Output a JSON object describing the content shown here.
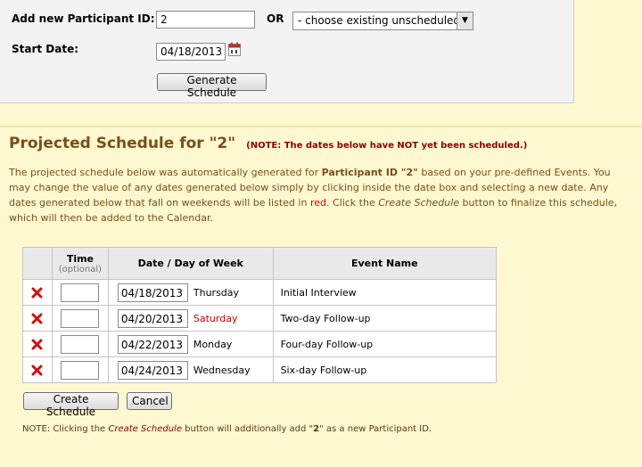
{
  "form": {
    "participant_label": "Add new Participant ID:",
    "participant_value": "2",
    "or_label": "OR",
    "existing_select_value": "- choose existing unscheduled -",
    "start_date_label": "Start Date:",
    "start_date_value": "04/18/2013",
    "generate_button": "Generate Schedule"
  },
  "schedule": {
    "title": "Projected Schedule for \"2\"",
    "note": "(NOTE: The dates below have NOT yet been scheduled.)",
    "desc_part1": "The projected schedule below was automatically generated for ",
    "desc_bold": "Participant ID \"2\"",
    "desc_part2": " based on your pre-defined Events. You may change the value of any dates generated below simply by clicking inside the date box and selecting a new date. Any dates generated below that fall on weekends will be listed in ",
    "desc_red": "red",
    "desc_part3": ". Click the ",
    "desc_italic": "Create Schedule",
    "desc_part4": " button to finalize this schedule, which will then be added to the Calendar.",
    "col_time": "Time",
    "col_time_sub": "(optional)",
    "col_date": "Date / Day of Week",
    "col_event": "Event Name",
    "rows": [
      {
        "date": "04/18/2013",
        "day": "Thursday",
        "event": "Initial Interview",
        "weekend": false
      },
      {
        "date": "04/20/2013",
        "day": "Saturday",
        "event": "Two-day Follow-up",
        "weekend": true
      },
      {
        "date": "04/22/2013",
        "day": "Monday",
        "event": "Four-day Follow-up",
        "weekend": false
      },
      {
        "date": "04/24/2013",
        "day": "Wednesday",
        "event": "Six-day Follow-up",
        "weekend": false
      }
    ],
    "create_button": "Create Schedule",
    "cancel_button": "Cancel",
    "footnote_part1": "NOTE: Clicking the ",
    "footnote_italic": "Create Schedule",
    "footnote_part2": " button will additionally add \"",
    "footnote_bold": "2",
    "footnote_part3": "\" as a new Participant ID."
  },
  "colors": {
    "weekend": "#cc0000",
    "title": "#7a4e1a",
    "note": "#8b0000",
    "background": "#fdf8d0"
  },
  "icons": {
    "delete": "red-x-icon",
    "calendar": "calendar-icon"
  }
}
